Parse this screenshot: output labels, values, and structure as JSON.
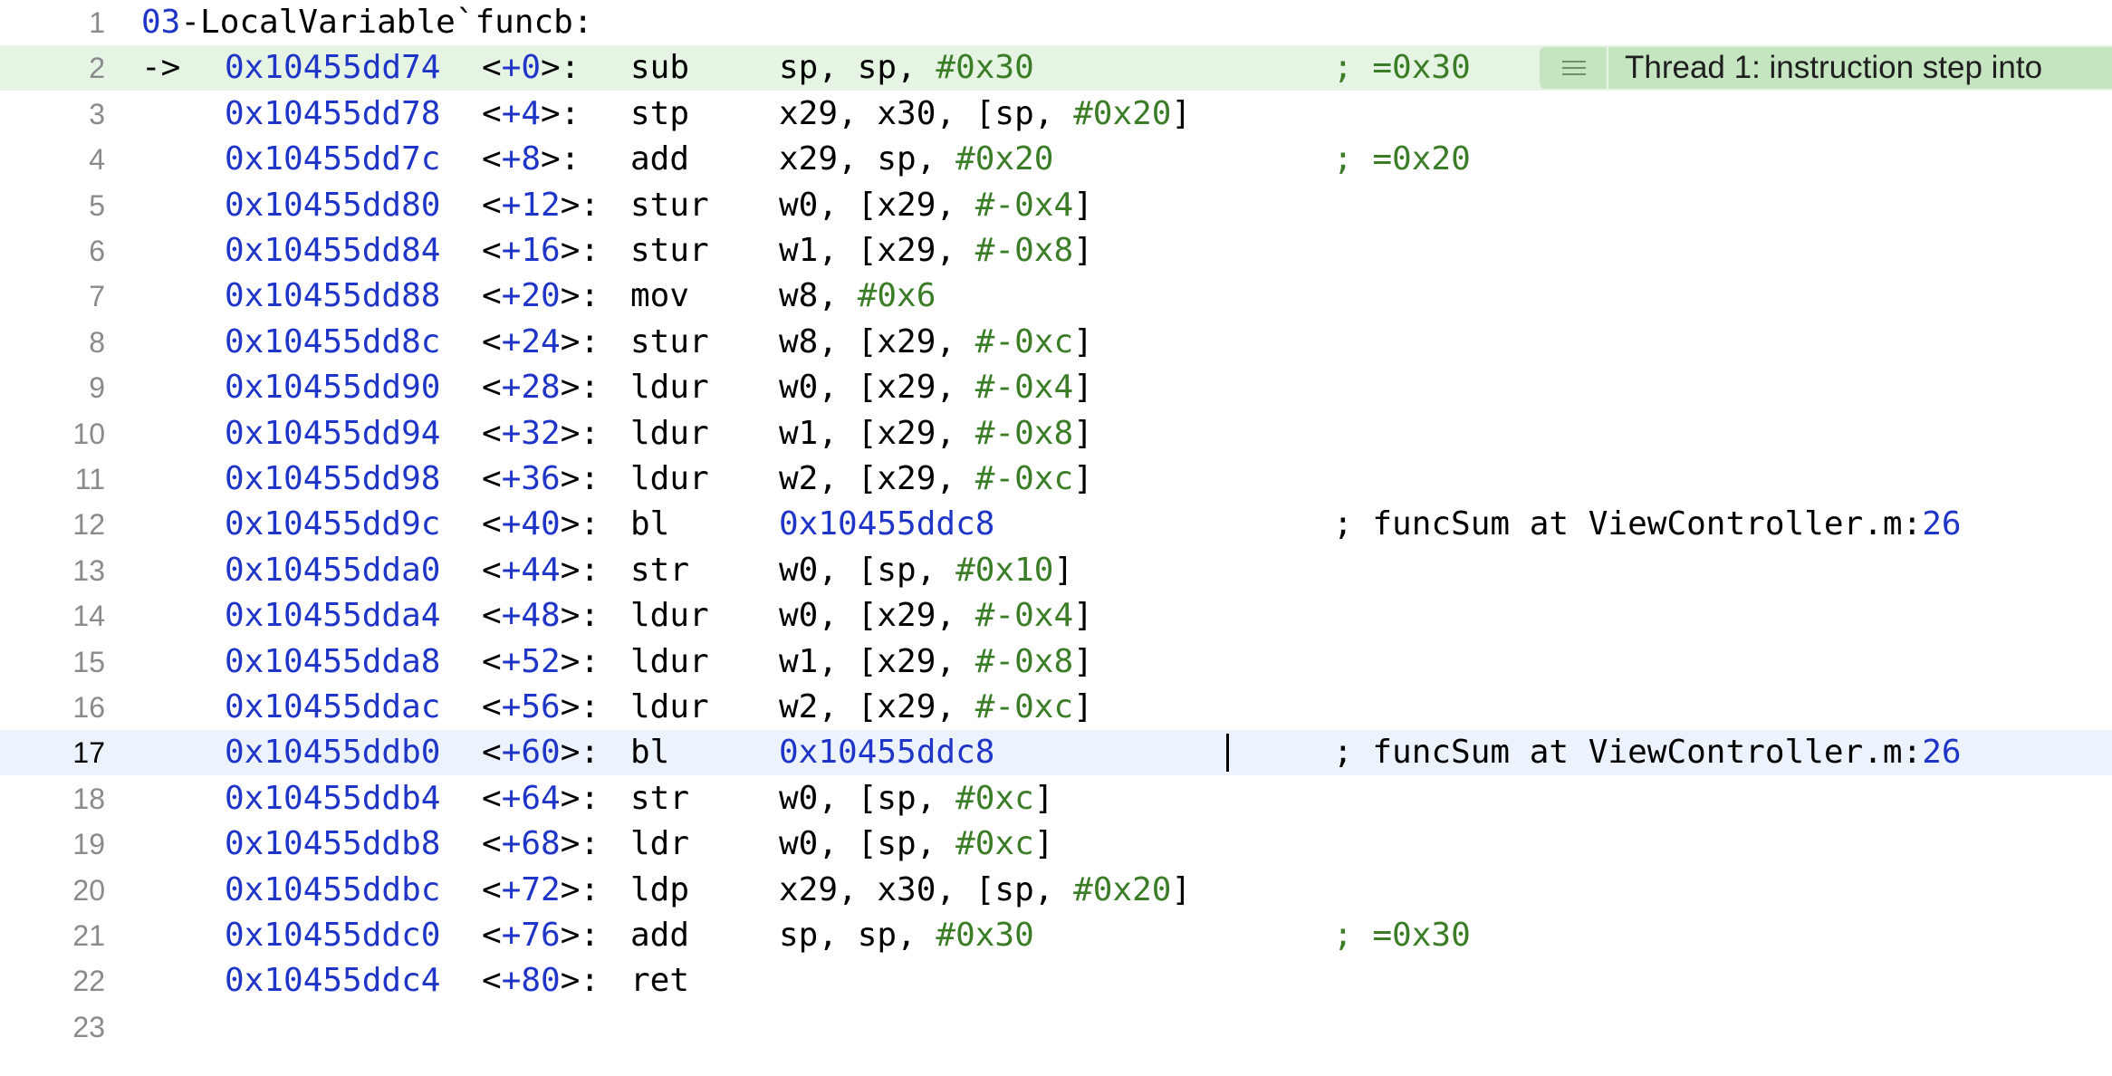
{
  "header": {
    "line_number": "1",
    "module": "03",
    "rest": "-LocalVariable`funcb:"
  },
  "pc_arrow": "->",
  "banner": {
    "icon": "list-lines-icon",
    "text": "Thread 1: instruction step into"
  },
  "instructions": [
    {
      "line_number": "2",
      "address": "0x10455dd74",
      "offset": "+0",
      "mnemonic": "sub",
      "operands": [
        [
          "sp, sp, ",
          "p"
        ],
        [
          "#0x30",
          "g"
        ]
      ],
      "comment": [
        [
          ";",
          "g"
        ],
        [
          " ",
          "p"
        ],
        [
          "=0x30",
          "g"
        ]
      ]
    },
    {
      "line_number": "3",
      "address": "0x10455dd78",
      "offset": "+4",
      "mnemonic": "stp",
      "operands": [
        [
          "x29, x30, [sp, ",
          "p"
        ],
        [
          "#0x20",
          "g"
        ],
        [
          "]",
          "p"
        ]
      ]
    },
    {
      "line_number": "4",
      "address": "0x10455dd7c",
      "offset": "+8",
      "mnemonic": "add",
      "operands": [
        [
          "x29, sp, ",
          "p"
        ],
        [
          "#0x20",
          "g"
        ]
      ],
      "comment": [
        [
          ";",
          "g"
        ],
        [
          " ",
          "p"
        ],
        [
          "=0x20",
          "g"
        ]
      ]
    },
    {
      "line_number": "5",
      "address": "0x10455dd80",
      "offset": "+12",
      "mnemonic": "stur",
      "operands": [
        [
          "w0, [x29, ",
          "p"
        ],
        [
          "#-0x4",
          "g"
        ],
        [
          "]",
          "p"
        ]
      ]
    },
    {
      "line_number": "6",
      "address": "0x10455dd84",
      "offset": "+16",
      "mnemonic": "stur",
      "operands": [
        [
          "w1, [x29, ",
          "p"
        ],
        [
          "#-0x8",
          "g"
        ],
        [
          "]",
          "p"
        ]
      ]
    },
    {
      "line_number": "7",
      "address": "0x10455dd88",
      "offset": "+20",
      "mnemonic": "mov",
      "operands": [
        [
          "w8, ",
          "p"
        ],
        [
          "#0x6",
          "g"
        ]
      ]
    },
    {
      "line_number": "8",
      "address": "0x10455dd8c",
      "offset": "+24",
      "mnemonic": "stur",
      "operands": [
        [
          "w8, [x29, ",
          "p"
        ],
        [
          "#-0xc",
          "g"
        ],
        [
          "]",
          "p"
        ]
      ]
    },
    {
      "line_number": "9",
      "address": "0x10455dd90",
      "offset": "+28",
      "mnemonic": "ldur",
      "operands": [
        [
          "w0, [x29, ",
          "p"
        ],
        [
          "#-0x4",
          "g"
        ],
        [
          "]",
          "p"
        ]
      ]
    },
    {
      "line_number": "10",
      "address": "0x10455dd94",
      "offset": "+32",
      "mnemonic": "ldur",
      "operands": [
        [
          "w1, [x29, ",
          "p"
        ],
        [
          "#-0x8",
          "g"
        ],
        [
          "]",
          "p"
        ]
      ]
    },
    {
      "line_number": "11",
      "address": "0x10455dd98",
      "offset": "+36",
      "mnemonic": "ldur",
      "operands": [
        [
          "w2, [x29, ",
          "p"
        ],
        [
          "#-0xc",
          "g"
        ],
        [
          "]",
          "p"
        ]
      ]
    },
    {
      "line_number": "12",
      "address": "0x10455dd9c",
      "offset": "+40",
      "mnemonic": "bl",
      "operands": [
        [
          "0x10455ddc8",
          "b"
        ]
      ],
      "comment": [
        [
          "; funcSum at ViewController.m:",
          "p"
        ],
        [
          "26",
          "b"
        ]
      ]
    },
    {
      "line_number": "13",
      "address": "0x10455dda0",
      "offset": "+44",
      "mnemonic": "str",
      "operands": [
        [
          "w0, [sp, ",
          "p"
        ],
        [
          "#0x10",
          "g"
        ],
        [
          "]",
          "p"
        ]
      ]
    },
    {
      "line_number": "14",
      "address": "0x10455dda4",
      "offset": "+48",
      "mnemonic": "ldur",
      "operands": [
        [
          "w0, [x29, ",
          "p"
        ],
        [
          "#-0x4",
          "g"
        ],
        [
          "]",
          "p"
        ]
      ]
    },
    {
      "line_number": "15",
      "address": "0x10455dda8",
      "offset": "+52",
      "mnemonic": "ldur",
      "operands": [
        [
          "w1, [x29, ",
          "p"
        ],
        [
          "#-0x8",
          "g"
        ],
        [
          "]",
          "p"
        ]
      ]
    },
    {
      "line_number": "16",
      "address": "0x10455ddac",
      "offset": "+56",
      "mnemonic": "ldur",
      "operands": [
        [
          "w2, [x29, ",
          "p"
        ],
        [
          "#-0xc",
          "g"
        ],
        [
          "]",
          "p"
        ]
      ]
    },
    {
      "line_number": "17",
      "address": "0x10455ddb0",
      "offset": "+60",
      "mnemonic": "bl",
      "operands": [
        [
          "0x10455ddc8",
          "b"
        ]
      ],
      "comment": [
        [
          "; funcSum at ViewController.m:",
          "p"
        ],
        [
          "26",
          "b"
        ]
      ]
    },
    {
      "line_number": "18",
      "address": "0x10455ddb4",
      "offset": "+64",
      "mnemonic": "str",
      "operands": [
        [
          "w0, [sp, ",
          "p"
        ],
        [
          "#0xc",
          "g"
        ],
        [
          "]",
          "p"
        ]
      ]
    },
    {
      "line_number": "19",
      "address": "0x10455ddb8",
      "offset": "+68",
      "mnemonic": "ldr",
      "operands": [
        [
          "w0, [sp, ",
          "p"
        ],
        [
          "#0xc",
          "g"
        ],
        [
          "]",
          "p"
        ]
      ]
    },
    {
      "line_number": "20",
      "address": "0x10455ddbc",
      "offset": "+72",
      "mnemonic": "ldp",
      "operands": [
        [
          "x29, x30, [sp, ",
          "p"
        ],
        [
          "#0x20",
          "g"
        ],
        [
          "]",
          "p"
        ]
      ]
    },
    {
      "line_number": "21",
      "address": "0x10455ddc0",
      "offset": "+76",
      "mnemonic": "add",
      "operands": [
        [
          "sp, sp, ",
          "p"
        ],
        [
          "#0x30",
          "g"
        ]
      ],
      "comment": [
        [
          ";",
          "g"
        ],
        [
          " ",
          "p"
        ],
        [
          "=0x30",
          "g"
        ]
      ]
    },
    {
      "line_number": "22",
      "address": "0x10455ddc4",
      "offset": "+80",
      "mnemonic": "ret",
      "operands": []
    }
  ],
  "trailing_line_number": "23",
  "pc_line": "2",
  "cursor_line": "17",
  "colors": {
    "address": "#1f35c7",
    "immediate": "#3b7d27",
    "pc_highlight": "#e6f4e3",
    "cursor_highlight": "#edf3fd",
    "banner": "#c4e5bf"
  }
}
